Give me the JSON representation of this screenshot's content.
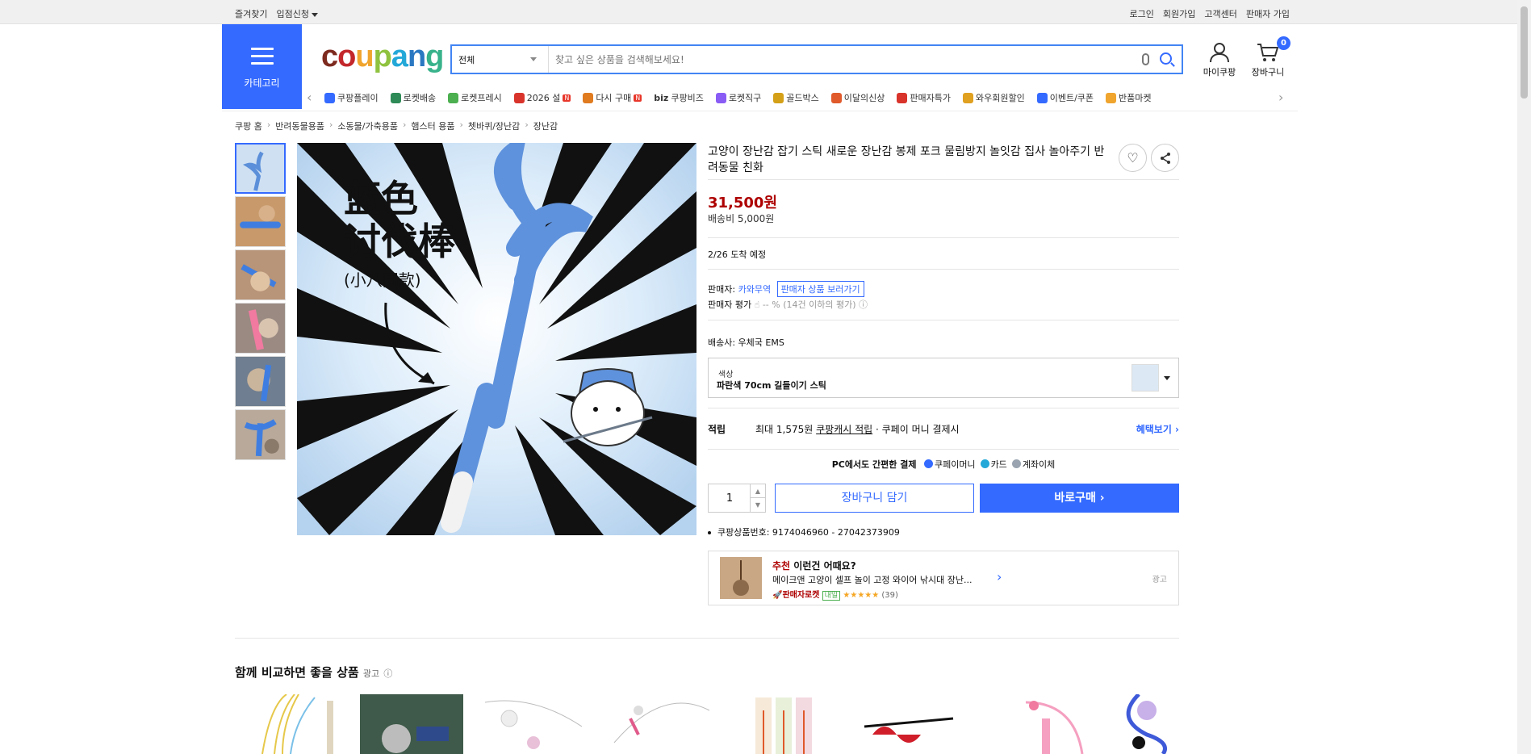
{
  "topbar": {
    "left": [
      "즐겨찾기",
      "입점신청"
    ],
    "right": [
      "로그인",
      "회원가입",
      "고객센터",
      "판매자 가입"
    ]
  },
  "header": {
    "category_label": "카테고리",
    "logo": [
      "c",
      "o",
      "u",
      "p",
      "a",
      "n",
      "g"
    ],
    "logo_colors": [
      "#7d2a1f",
      "#c3272b",
      "#f0a52e",
      "#8fc23f",
      "#23a8d8",
      "#2b78c2",
      "#38b28b"
    ],
    "search": {
      "select_value": "전체",
      "placeholder": "찾고 싶은 상품을 검색해보세요!"
    },
    "mycoupang": "마이쿠팡",
    "cart": "장바구니",
    "cart_count": "0"
  },
  "nav": [
    {
      "label": "쿠팡플레이",
      "color": "#346aff"
    },
    {
      "label": "로켓배송",
      "color": "#2e8b57"
    },
    {
      "label": "로켓프레시",
      "color": "#4caf50"
    },
    {
      "label": "2026 설",
      "color": "#d9342b",
      "badge": "N"
    },
    {
      "label": "다시 구매",
      "color": "#e07b20",
      "badge": "N"
    },
    {
      "label": "쿠팡비즈",
      "color": "#333333",
      "prefix": "biz"
    },
    {
      "label": "로켓직구",
      "color": "#8a5cf6"
    },
    {
      "label": "골드박스",
      "color": "#d4a017"
    },
    {
      "label": "이달의신상",
      "color": "#e05a2b"
    },
    {
      "label": "판매자특가",
      "color": "#d9342b"
    },
    {
      "label": "와우회원할인",
      "color": "#e0a020"
    },
    {
      "label": "이벤트/쿠폰",
      "color": "#346aff"
    },
    {
      "label": "반품마켓",
      "color": "#f0a52e"
    }
  ],
  "breadcrumb": [
    "쿠팡 홈",
    "반려동물용품",
    "소동물/가축용품",
    "햄스터 용품",
    "쳇바퀴/장난감",
    "장난감"
  ],
  "product": {
    "title": "고양이 장난감 잡기 스틱 새로운 장난감 봉제 포크 물림방지 놀잇감 집사 놀아주기 반려동물 친화",
    "price": "31,500원",
    "shipping": "배송비 5,000원",
    "arrival": "2/26 도착 예정",
    "seller_label": "판매자:",
    "seller_name": "카와무역",
    "seller_link": "판매자 상품 보러가기",
    "rating_label": "판매자 평가",
    "rating_value": "-- % (14건 이하의 평가)",
    "delivery": "배송사: 우체국 EMS",
    "option_key": "색상",
    "option_value": "파란색 70cm 길들이기 스틱",
    "reward_label": "적립",
    "reward_text1": "최대 1,575원",
    "reward_text2": "쿠팡캐시 적립",
    "reward_text3": "· 쿠페이 머니 결제시",
    "reward_more": "혜택보기",
    "pc_pay": "PC에서도 간편한 결제",
    "pay_methods": [
      {
        "label": "쿠페이머니",
        "color": "#346aff"
      },
      {
        "label": "카드",
        "color": "#23a8d8"
      },
      {
        "label": "계좌이체",
        "color": "#9aa4b0"
      }
    ],
    "qty": "1",
    "cart_btn": "장바구니 담기",
    "buy_btn": "바로구매",
    "product_no": "쿠팡상품번호: 9174046960 - 27042373909",
    "image_text": {
      "line1": "蓝色",
      "line2": "讨伐棒",
      "line3": "(小八同款)"
    }
  },
  "recommend": {
    "head_red": "추천",
    "head": "이런건 어때요?",
    "desc": "메이크앤 고양이 셀프 놀이 고정 와이어 낚시대 장난...",
    "tag": "판매자로켓",
    "tag2": "내일",
    "stars": "★★★★★",
    "count": "(39)",
    "ad": "광고"
  },
  "compare": {
    "title": "함께 비교하면 좋을 상품",
    "ad": "광고"
  }
}
